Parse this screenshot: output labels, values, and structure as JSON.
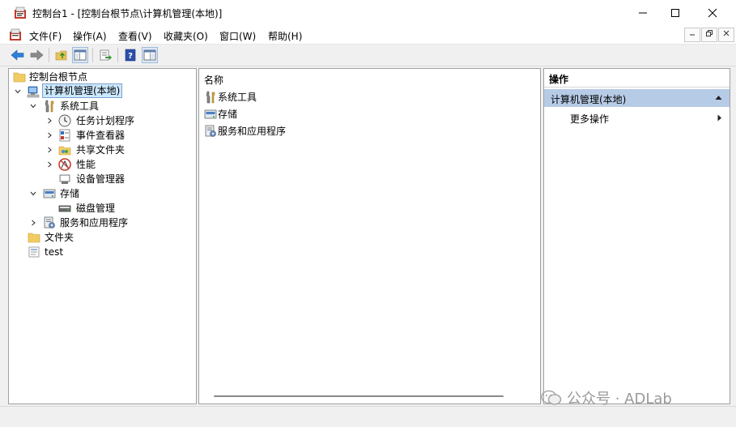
{
  "window": {
    "title": "控制台1 - [控制台根节点\\计算机管理(本地)]"
  },
  "menu": [
    "文件(F)",
    "操作(A)",
    "查看(V)",
    "收藏夹(O)",
    "窗口(W)",
    "帮助(H)"
  ],
  "tree": {
    "root": "控制台根节点",
    "computer": "计算机管理(本地)",
    "system_tools": "系统工具",
    "task_scheduler": "任务计划程序",
    "event_viewer": "事件查看器",
    "shared_folders": "共享文件夹",
    "performance": "性能",
    "device_manager": "设备管理器",
    "storage": "存储",
    "disk_management": "磁盘管理",
    "services_apps": "服务和应用程序",
    "folder": "文件夹",
    "test": "test"
  },
  "list": {
    "column_header": "名称",
    "items": [
      "系统工具",
      "存储",
      "服务和应用程序"
    ]
  },
  "actions": {
    "header": "操作",
    "section": "计算机管理(本地)",
    "more": "更多操作"
  },
  "watermark": "公众号 · ADLab"
}
